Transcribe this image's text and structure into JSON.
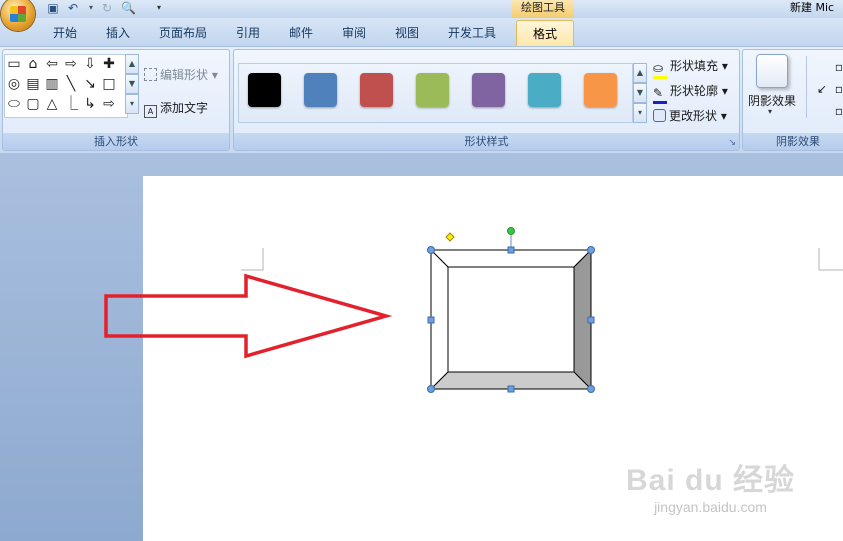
{
  "window": {
    "context_tab_group": "绘图工具",
    "title": "新建 Mic"
  },
  "tabs": [
    "开始",
    "插入",
    "页面布局",
    "引用",
    "邮件",
    "审阅",
    "视图",
    "开发工具",
    "格式"
  ],
  "active_tab": "格式",
  "groups": {
    "insert_shapes": {
      "label": "插入形状",
      "edit_shape": "编辑形状",
      "add_text": "添加文字"
    },
    "shape_styles": {
      "label": "形状样式",
      "swatches": [
        "#000000",
        "#4f81bd",
        "#c0504d",
        "#9bbb59",
        "#8064a2",
        "#4bacc6",
        "#f79646"
      ],
      "fill": "形状填充",
      "outline": "形状轮廓",
      "change_shape": "更改形状"
    },
    "shadow": {
      "label": "阴影效果",
      "button": "阴影效果"
    }
  },
  "watermark": {
    "logo": "Bai du 经验",
    "url": "jingyan.baidu.com"
  }
}
